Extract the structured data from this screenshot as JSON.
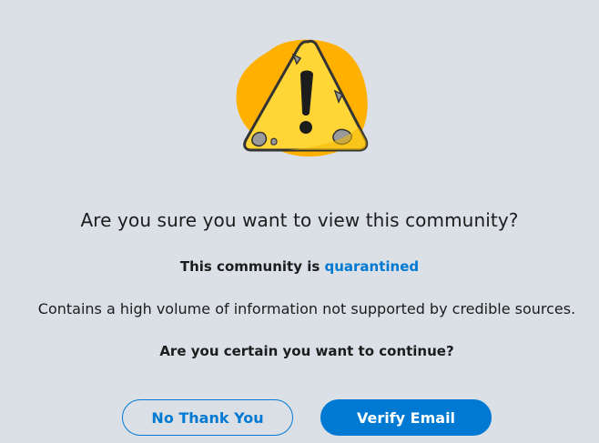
{
  "dialog": {
    "title": "Are you sure you want to view this community?",
    "status_prefix": "This community is",
    "status_link": "quarantined",
    "reason": "Contains a high volume of information not supported by credible sources.",
    "confirm_question": "Are you certain you want to continue?"
  },
  "actions": {
    "decline_label": "No Thank You",
    "verify_label": "Verify Email"
  },
  "illustration": {
    "icon": "warning-triangle-icon",
    "blob_color": "#ffb000",
    "triangle_color": "#ffd635",
    "accent_color": "#0079d3"
  }
}
